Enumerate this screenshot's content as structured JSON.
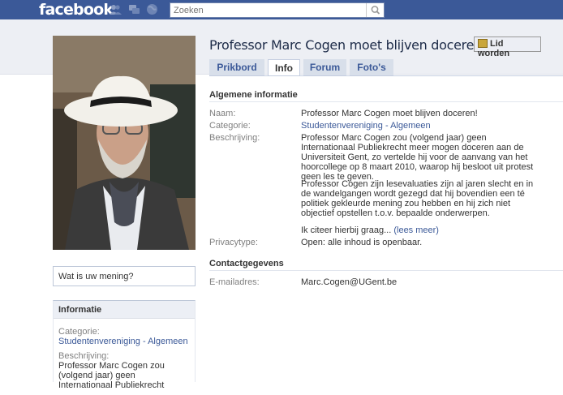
{
  "topbar": {
    "logo": "facebook",
    "search_placeholder": "Zoeken"
  },
  "page": {
    "title": "Professor Marc Cogen moet blijven doceren!",
    "join_button": "Lid worden"
  },
  "tabs": [
    {
      "label": "Prikbord",
      "active": false
    },
    {
      "label": "Info",
      "active": true
    },
    {
      "label": "Forum",
      "active": false
    },
    {
      "label": "Foto's",
      "active": false
    }
  ],
  "general": {
    "heading": "Algemene informatie",
    "name_label": "Naam:",
    "name_value": "Professor Marc Cogen moet blijven doceren!",
    "category_label": "Categorie:",
    "category_part1": "Studentenvereniging",
    "category_sep": " - ",
    "category_part2": "Algemeen",
    "description_label": "Beschrijving:",
    "description_p1": "Professor Marc Cogen zou (volgend jaar) geen Internationaal Publiekrecht meer mogen doceren aan de Universiteit Gent, zo vertelde hij voor de aanvang van het hoorcollege op 8 maart 2010, waarop hij besloot uit protest geen les te geven.",
    "description_p2": "Professor Cogen zijn lesevaluaties zijn al jaren slecht en in de wandelgangen wordt gezegd dat hij bovendien een té politiek gekleurde mening zou hebben en hij zich niet objectief opstellen t.o.v. bepaalde onderwerpen.",
    "description_p3": "Ik citeer hierbij graag...",
    "read_more": "(lees meer)",
    "privacy_label": "Privacytype:",
    "privacy_value": "Open: alle inhoud is openbaar."
  },
  "contact": {
    "heading": "Contactgegevens",
    "email_label": "E-mailadres:",
    "email_value": "Marc.Cogen@UGent.be"
  },
  "sidebar": {
    "opinion_placeholder": "Wat is uw mening?",
    "info_heading": "Informatie",
    "category_label": "Categorie:",
    "category_part1": "Studentenvereniging",
    "category_sep": " - ",
    "category_part2": "Algemeen",
    "description_label": "Beschrijving:",
    "description_text": "Professor Marc Cogen zou (volgend jaar) geen Internationaal Publiekrecht"
  },
  "colors": {
    "facebook_blue": "#3b5998",
    "band_grey": "#edeff4"
  }
}
